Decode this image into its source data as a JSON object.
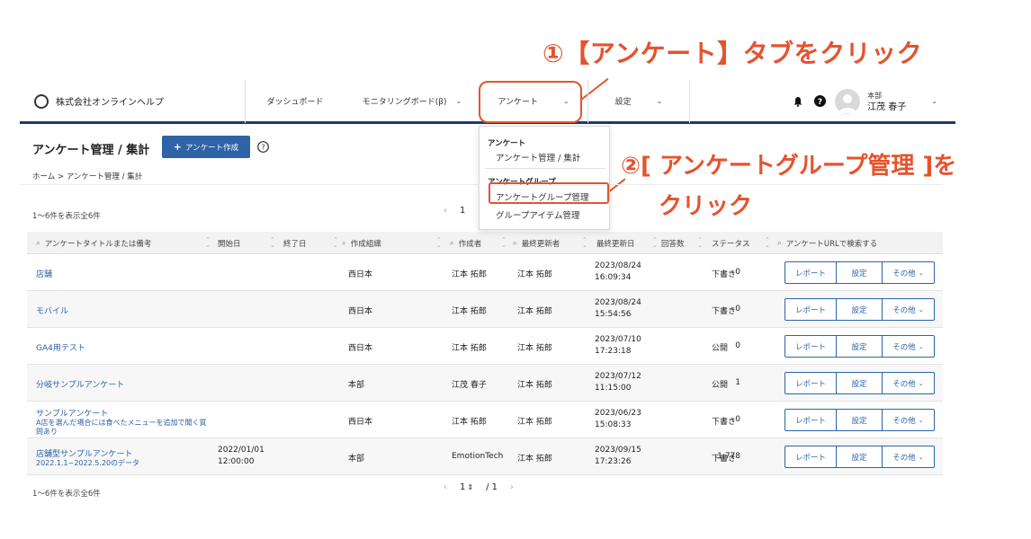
{
  "annotations": {
    "step1": "①【アンケート】タブをクリック",
    "step2_line1": "②[ アンケートグループ管理 ]を",
    "step2_line2": "クリック"
  },
  "header": {
    "company": "株式会社オンラインヘルプ",
    "nav": {
      "dashboard": "ダッシュボード",
      "monitoring": "モニタリングボード(β)",
      "enquete": "アンケート",
      "settings": "設定"
    },
    "user": {
      "dept": "本部",
      "name": "江茂 春子"
    }
  },
  "page": {
    "title": "アンケート管理 / 集計",
    "create_button": "アンケート作成",
    "breadcrumb": "ホーム > アンケート管理 / 集計",
    "count_label": "1～6件を表示全6件",
    "pager_top_page": "1",
    "pager_bottom": {
      "current": "1",
      "total": "/ 1"
    }
  },
  "dropdown": {
    "group1_title": "アンケート",
    "item1": "アンケート管理 / 集計",
    "group2_title": "アンケートグループ",
    "item2": "アンケートグループ管理",
    "item3": "グループアイテム管理"
  },
  "table": {
    "headers": {
      "title": "アンケートタイトルまたは備考",
      "start": "開始日",
      "end": "終了日",
      "org": "作成組織",
      "creator": "作成者",
      "updater": "最終更新者",
      "updated": "最終更新日",
      "answers": "回答数",
      "status": "ステータス",
      "url": "アンケートURLで検索する"
    },
    "actions": {
      "report": "レポート",
      "settings": "設定",
      "more": "その他"
    },
    "rows": [
      {
        "title": "店舗",
        "subtitle": "",
        "start_date": "",
        "start_time": "",
        "org": "西日本",
        "creator": "江本 拓郎",
        "updater": "江本 拓郎",
        "updated_date": "2023/08/24",
        "updated_time": "16:09:34",
        "answers": "0",
        "status": "下書き"
      },
      {
        "title": "モバイル",
        "subtitle": "",
        "start_date": "",
        "start_time": "",
        "org": "西日本",
        "creator": "江本 拓郎",
        "updater": "江本 拓郎",
        "updated_date": "2023/08/24",
        "updated_time": "15:54:56",
        "answers": "0",
        "status": "下書き"
      },
      {
        "title": "GA4用テスト",
        "subtitle": "",
        "start_date": "",
        "start_time": "",
        "org": "西日本",
        "creator": "江本 拓郎",
        "updater": "江本 拓郎",
        "updated_date": "2023/07/10",
        "updated_time": "17:23:18",
        "answers": "0",
        "status": "公開"
      },
      {
        "title": "分岐サンプルアンケート",
        "subtitle": "",
        "start_date": "",
        "start_time": "",
        "org": "本部",
        "creator": "江茂 春子",
        "updater": "江本 拓郎",
        "updated_date": "2023/07/12",
        "updated_time": "11:15:00",
        "answers": "1",
        "status": "公開"
      },
      {
        "title": "サンプルアンケート",
        "subtitle": "A店を選んだ場合には食べたメニューを追加で聞く質問あり",
        "start_date": "",
        "start_time": "",
        "org": "西日本",
        "creator": "江本 拓郎",
        "updater": "江本 拓郎",
        "updated_date": "2023/06/23",
        "updated_time": "15:08:33",
        "answers": "0",
        "status": "下書き"
      },
      {
        "title": "店舗型サンプルアンケート",
        "subtitle": "2022.1.1~2022.5.20のデータ",
        "start_date": "2022/01/01",
        "start_time": "12:00:00",
        "org": "本部",
        "creator": "EmotionTech",
        "updater": "江本 拓郎",
        "updated_date": "2023/09/15",
        "updated_time": "17:23:26",
        "answers": "1,778",
        "status": "下書き"
      }
    ]
  },
  "colors": {
    "accent": "#e5532d",
    "primary": "#2e63a6",
    "nav_border": "#1c3a6e"
  }
}
